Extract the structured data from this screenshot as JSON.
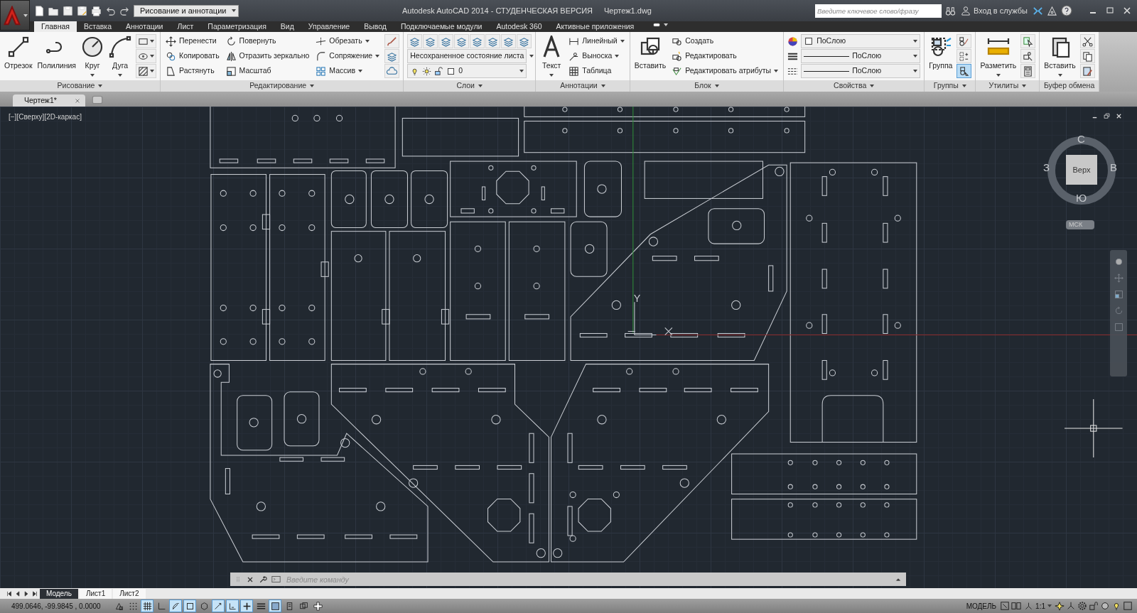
{
  "window": {
    "title": "Autodesk AutoCAD 2014 - СТУДЕНЧЕСКАЯ ВЕРСИЯ",
    "document": "Чертеж1.dwg"
  },
  "workspace": {
    "value": "Рисование и аннотации"
  },
  "search": {
    "placeholder": "Введите ключевое слово/фразу"
  },
  "sign_in": {
    "label": "Вход в службы"
  },
  "ribbon_tabs": [
    {
      "label": "Главная",
      "selected": true
    },
    {
      "label": "Вставка",
      "selected": false
    },
    {
      "label": "Аннотации",
      "selected": false
    },
    {
      "label": "Лист",
      "selected": false
    },
    {
      "label": "Параметризация",
      "selected": false
    },
    {
      "label": "Вид",
      "selected": false
    },
    {
      "label": "Управление",
      "selected": false
    },
    {
      "label": "Вывод",
      "selected": false
    },
    {
      "label": "Подключаемые модули",
      "selected": false
    },
    {
      "label": "Autodesk 360",
      "selected": false
    },
    {
      "label": "Активные приложения",
      "selected": false
    }
  ],
  "ribbon_panels": [
    {
      "title": "Рисование",
      "has_menu": true,
      "columns": [
        [
          {
            "kind": "large",
            "label": "Отрезок",
            "caret": false
          }
        ],
        [
          {
            "kind": "large",
            "label": "Полилиния",
            "caret": false
          }
        ],
        [
          {
            "kind": "large",
            "label": "Круг",
            "caret": true
          }
        ],
        [
          {
            "kind": "large",
            "label": "Дуга",
            "caret": true
          }
        ],
        [
          {
            "kind": "icon",
            "caret": true
          },
          {
            "kind": "icon",
            "caret": true
          },
          {
            "kind": "icon",
            "caret": true
          }
        ]
      ]
    },
    {
      "title": "Редактирование",
      "has_menu": true,
      "columns": [
        [
          {
            "kind": "small",
            "label": "Перенести",
            "caret": false
          },
          {
            "kind": "small",
            "label": "Копировать",
            "caret": false
          },
          {
            "kind": "small",
            "label": "Растянуть",
            "caret": false
          }
        ],
        [
          {
            "kind": "small",
            "label": "Повернуть",
            "caret": false
          },
          {
            "kind": "small",
            "label": "Отразить зеркально",
            "caret": false
          },
          {
            "kind": "small",
            "label": "Масштаб",
            "caret": false
          }
        ],
        [
          {
            "kind": "small",
            "label": "Обрезать",
            "caret": true
          },
          {
            "kind": "small",
            "label": "Сопряжение",
            "caret": true
          },
          {
            "kind": "small",
            "label": "Массив",
            "caret": true
          }
        ],
        [
          {
            "kind": "icon",
            "caret": false
          },
          {
            "kind": "icon",
            "caret": false
          },
          {
            "kind": "icon",
            "caret": false
          }
        ]
      ]
    },
    {
      "title": "Слои",
      "has_menu": true,
      "columns": [
        [
          {
            "kind": "row",
            "items": [
              {
                "kind": "icon",
                "caret": false
              },
              {
                "kind": "icon",
                "caret": false
              },
              {
                "kind": "icon",
                "caret": false
              },
              {
                "kind": "icon",
                "caret": false
              },
              {
                "kind": "icon",
                "caret": false
              },
              {
                "kind": "icon",
                "caret": false
              },
              {
                "kind": "icon",
                "caret": false
              },
              {
                "kind": "icon",
                "caret": false
              }
            ]
          },
          {
            "kind": "combo",
            "value": "Несохраненное состояние листа"
          },
          {
            "kind": "layer_combo",
            "value": "0"
          }
        ]
      ]
    },
    {
      "title": "Аннотации",
      "has_menu": true,
      "columns": [
        [
          {
            "kind": "large",
            "label": "Текст",
            "caret": true
          }
        ],
        [
          {
            "kind": "small",
            "label": "Линейный",
            "caret": true
          },
          {
            "kind": "small",
            "label": "Выноска",
            "caret": true
          },
          {
            "kind": "small",
            "label": "Таблица",
            "caret": false
          }
        ]
      ]
    },
    {
      "title": "Блок",
      "has_menu": true,
      "columns": [
        [
          {
            "kind": "large",
            "label": "Вставить",
            "caret": false
          }
        ],
        [
          {
            "kind": "small",
            "label": "Создать",
            "caret": false
          },
          {
            "kind": "small",
            "label": "Редактировать",
            "caret": false
          },
          {
            "kind": "small",
            "label": "Редактировать атрибуты",
            "caret": true
          }
        ]
      ]
    },
    {
      "title": "Свойства",
      "has_menu": true,
      "columns": [
        [
          {
            "kind": "color_combo",
            "value": "ПоСлою"
          },
          {
            "kind": "line_combo",
            "value": "ПоСлою"
          },
          {
            "kind": "line_combo",
            "value": "ПоСлою"
          }
        ]
      ]
    },
    {
      "title": "Группы",
      "has_menu": true,
      "columns": [
        [
          {
            "kind": "large",
            "label": "Группа",
            "caret": false
          }
        ],
        [
          {
            "kind": "icon",
            "caret": false,
            "on": false
          },
          {
            "kind": "icon",
            "caret": false,
            "on": false
          },
          {
            "kind": "icon",
            "caret": false,
            "on": true
          }
        ]
      ]
    },
    {
      "title": "Утилиты",
      "has_menu": true,
      "columns": [
        [
          {
            "kind": "large",
            "label": "Разметить",
            "caret": true
          }
        ],
        [
          {
            "kind": "icon",
            "caret": false
          },
          {
            "kind": "icon",
            "caret": false
          },
          {
            "kind": "icon",
            "caret": false
          }
        ]
      ]
    },
    {
      "title": "Буфер обмена",
      "has_menu": false,
      "columns": [
        [
          {
            "kind": "large",
            "label": "Вставить",
            "caret": true
          }
        ],
        [
          {
            "kind": "icon",
            "caret": false
          },
          {
            "kind": "icon",
            "caret": false
          },
          {
            "kind": "icon",
            "caret": false
          }
        ]
      ]
    }
  ],
  "document_tabs": [
    {
      "label": "Чертеж1*",
      "selected": true
    }
  ],
  "viewport": {
    "label": "[−][Сверху][2D-каркас]",
    "ucs_axis": "Y"
  },
  "viewcube": {
    "face": "Верх",
    "north": "С",
    "east": "В",
    "south": "Ю",
    "west": "З",
    "ucs": "МСК"
  },
  "command_line": {
    "placeholder": "Введите команду"
  },
  "layout_tabs": [
    {
      "label": "Модель",
      "selected": true
    },
    {
      "label": "Лист1",
      "selected": false
    },
    {
      "label": "Лист2",
      "selected": false
    }
  ],
  "status_bar": {
    "coordinates": "499.0646, -99.9845 , 0.0000",
    "toggles": [
      {
        "on": false
      },
      {
        "on": false
      },
      {
        "on": true
      },
      {
        "on": false
      },
      {
        "on": true
      },
      {
        "on": true
      },
      {
        "on": false
      },
      {
        "on": true
      },
      {
        "on": true
      },
      {
        "on": true
      },
      {
        "on": false
      },
      {
        "on": true
      },
      {
        "on": false
      },
      {
        "on": false
      },
      {
        "on": false
      }
    ],
    "space": "МОДЕЛЬ",
    "annotation_scale": "1:1"
  }
}
